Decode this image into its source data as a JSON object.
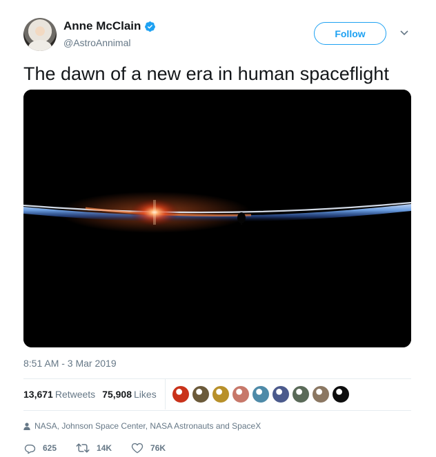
{
  "header": {
    "name": "Anne McClain",
    "handle": "@AstroAnnimal",
    "follow_label": "Follow",
    "avatar_icon": "astronaut-avatar",
    "verified_icon": "verified-badge-icon",
    "menu_icon": "chevron-down-icon"
  },
  "tweet": {
    "text": "The dawn of a new era in human spaceflight",
    "timestamp": "8:51 AM - 3 Mar 2019"
  },
  "stats": {
    "retweets_count": "13,671",
    "retweets_label": "Retweets",
    "likes_count": "75,908",
    "likes_label": "Likes",
    "likers": [
      {
        "color": "#c9321a"
      },
      {
        "color": "#6b5a3a"
      },
      {
        "color": "#b8902a"
      },
      {
        "color": "#c7786a"
      },
      {
        "color": "#4e8aa8"
      },
      {
        "color": "#4b5a8c"
      },
      {
        "color": "#5a6a58"
      },
      {
        "color": "#8b7762"
      },
      {
        "color": "#0d0d0d"
      }
    ]
  },
  "context": {
    "text": "NASA, Johnson Space Center, NASA Astronauts and SpaceX",
    "icon": "person-icon"
  },
  "actions": {
    "replies": "625",
    "retweets": "14K",
    "likes": "76K"
  },
  "colors": {
    "accent": "#1da1f2",
    "muted": "#657786",
    "text": "#14171a"
  }
}
